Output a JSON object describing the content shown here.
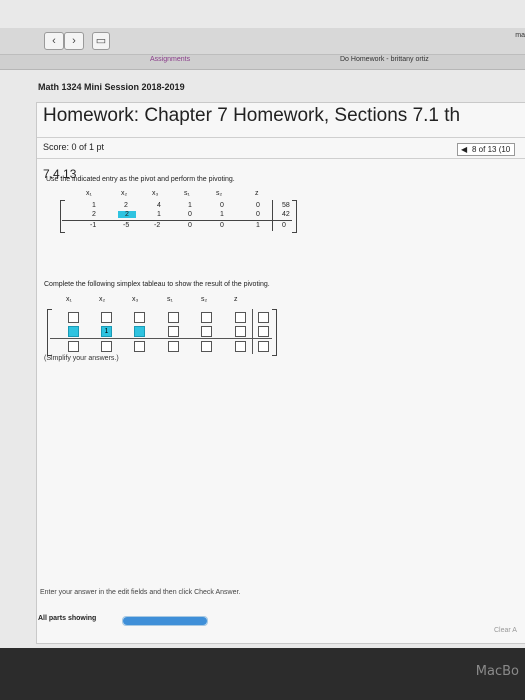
{
  "browser": {
    "back_glyph": "‹",
    "forward_glyph": "›",
    "tab_left": "Assignments",
    "tab_right": "Do Homework - brittany ortiz",
    "url_fragment": "ma"
  },
  "course": "Math 1324 Mini Session 2018-2019",
  "title": "Homework: Chapter 7 Homework, Sections 7.1 th",
  "score": "Score: 0 of 1 pt",
  "pager": "8 of 13 (10",
  "question_number": "7.4.13",
  "instruction": "Use the indicated entry as the pivot and perform the pivoting.",
  "headers": [
    "x₁",
    "x₂",
    "x₃",
    "s₁",
    "s₂",
    "z"
  ],
  "tableau": [
    [
      "1",
      "2",
      "4",
      "1",
      "0",
      "0",
      "58"
    ],
    [
      "2",
      "2",
      "1",
      "0",
      "1",
      "0",
      "42"
    ],
    [
      "-1",
      "-5",
      "-2",
      "0",
      "0",
      "1",
      "0"
    ]
  ],
  "pivot": {
    "row": 2,
    "col": 2
  },
  "complete_prompt": "Complete the following simplex tableau to show the result of the pivoting.",
  "answer_known": "1",
  "simplify_note": "(Simplify your answers.)",
  "footer_hint": "Enter your answer in the edit fields and then click Check Answer.",
  "parts_label": "All parts showing",
  "progress": 1.0,
  "clear_label": "Clear A",
  "macbook": "MacBo",
  "colors": {
    "accent": "#2fc3e0",
    "progress": "#3f8fd8"
  }
}
